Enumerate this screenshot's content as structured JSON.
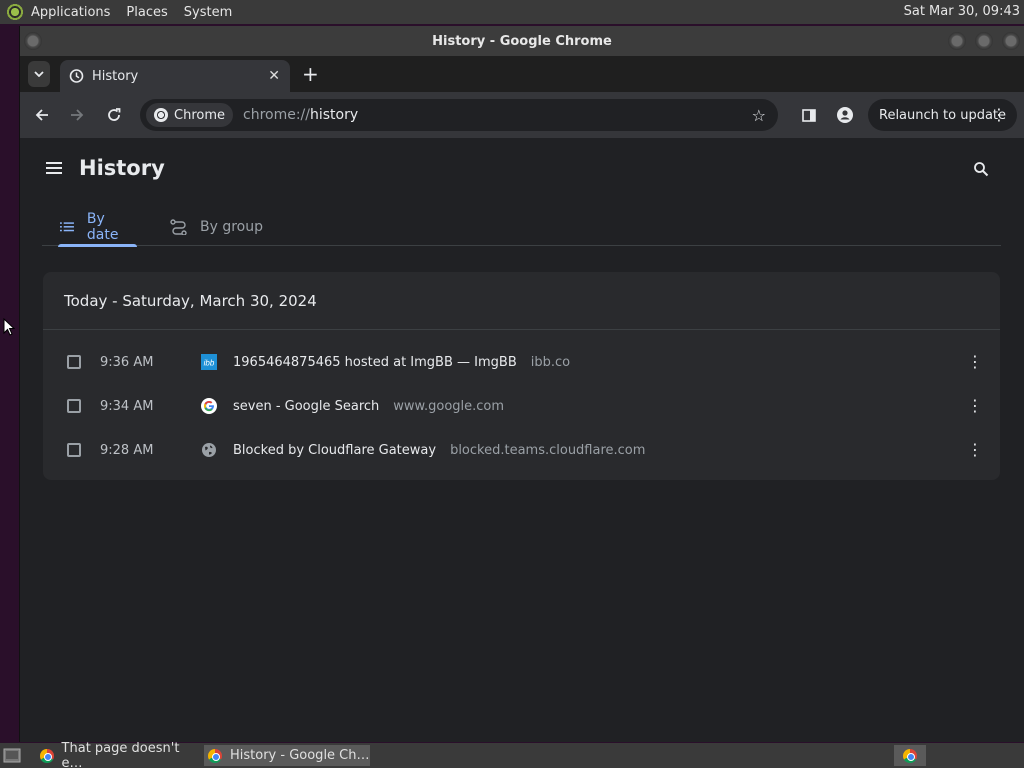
{
  "top_panel": {
    "menus": [
      "Applications",
      "Places",
      "System"
    ],
    "clock": "Sat Mar 30, 09:43"
  },
  "window": {
    "title": "History - Google Chrome"
  },
  "browser": {
    "tab": {
      "label": "History"
    },
    "omnibox": {
      "chip_label": "Chrome",
      "url_scheme": "chrome://",
      "url_host": "history"
    },
    "relaunch_label": "Relaunch to update"
  },
  "history": {
    "page_title": "History",
    "tabs": [
      "By date",
      "By group"
    ],
    "section_header": "Today - Saturday, March 30, 2024",
    "entries": [
      {
        "time": "9:36 AM",
        "title": "1965464875465 hosted at ImgBB — ImgBB",
        "domain": "ibb.co",
        "favicon": "imgbb-icon"
      },
      {
        "time": "9:34 AM",
        "title": "seven - Google Search",
        "domain": "www.google.com",
        "favicon": "google-icon"
      },
      {
        "time": "9:28 AM",
        "title": "Blocked by Cloudflare Gateway",
        "domain": "blocked.teams.cloudflare.com",
        "favicon": "globe-icon"
      }
    ]
  },
  "taskbar": {
    "tasks": [
      "That page doesn't e…",
      "History - Google Ch…"
    ]
  },
  "colors": {
    "accent": "#8ab4f8",
    "page_bg": "#202124",
    "card_bg": "#292a2d",
    "toolbar_bg": "#35363a"
  }
}
